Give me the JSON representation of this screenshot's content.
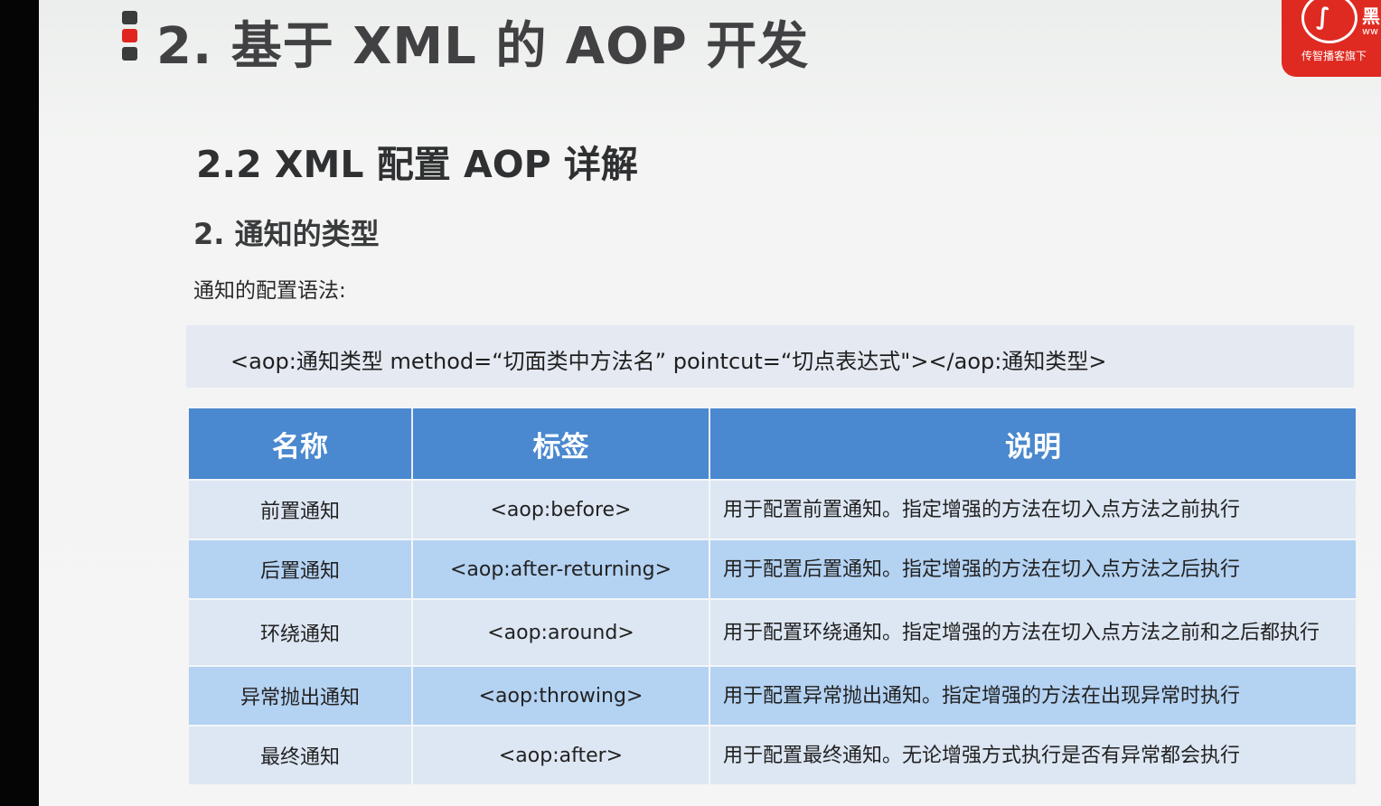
{
  "slide": {
    "main_title": "2. 基于 XML 的 AOP 开发",
    "sub_title": "2.2 XML 配置 AOP 详解",
    "section_title": "2. 通知的类型",
    "syntax_label": "通知的配置语法:",
    "syntax_code": "<aop:通知类型 method=“切面类中方法名” pointcut=“切点表达式\"></aop:通知类型>"
  },
  "logo": {
    "char": "黑",
    "www": "ww",
    "subtitle": "传智播客旗下",
    "icon": "horse-logo-icon"
  },
  "table": {
    "headers": [
      "名称",
      "标签",
      "说明"
    ],
    "rows": [
      {
        "name": "前置通知",
        "tag": "<aop:before>",
        "desc": "用于配置前置通知。指定增强的方法在切入点方法之前执行"
      },
      {
        "name": "后置通知",
        "tag": "<aop:after-returning>",
        "desc": "用于配置后置通知。指定增强的方法在切入点方法之后执行"
      },
      {
        "name": "环绕通知",
        "tag": "<aop:around>",
        "desc": "用于配置环绕通知。指定增强的方法在切入点方法之前和之后都执行"
      },
      {
        "name": "异常抛出通知",
        "tag": "<aop:throwing>",
        "desc": "用于配置异常抛出通知。指定增强的方法在出现异常时执行"
      },
      {
        "name": "最终通知",
        "tag": "<aop:after>",
        "desc": "用于配置最终通知。无论增强方式执行是否有异常都会执行"
      }
    ]
  },
  "colors": {
    "header_blue": "#4a88cf",
    "row_light": "#dde7f3",
    "row_dark": "#b4d2f2",
    "accent_red": "#e02520"
  }
}
